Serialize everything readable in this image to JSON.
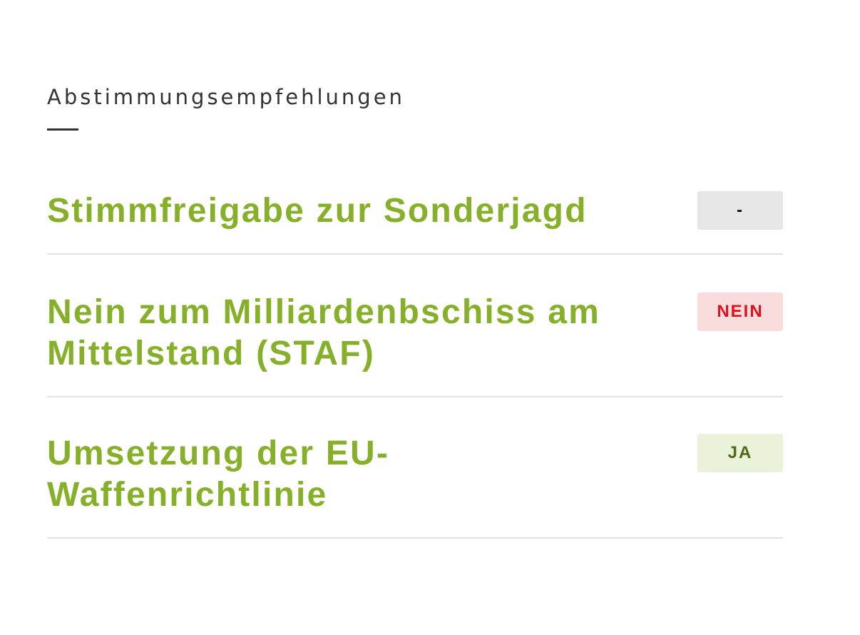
{
  "section": {
    "title": "Abstimmungsempfehlungen"
  },
  "items": [
    {
      "title": "Stimmfreigabe zur Sonderjagd",
      "recommendation": "-"
    },
    {
      "title": "Nein zum Milliardenbschiss am Mittelstand (STAF)",
      "recommendation": "NEIN"
    },
    {
      "title": "Umsetzung der EU-Waffenrichtlinie",
      "recommendation": "JA"
    }
  ],
  "colors": {
    "title_green": "#86b02a",
    "neutral_badge_bg": "#e6e6e6",
    "nein_badge_bg": "#f9dcdc",
    "nein_badge_text": "#e2101b",
    "ja_badge_bg": "#ebf2da",
    "ja_badge_text": "#4c6b13"
  }
}
